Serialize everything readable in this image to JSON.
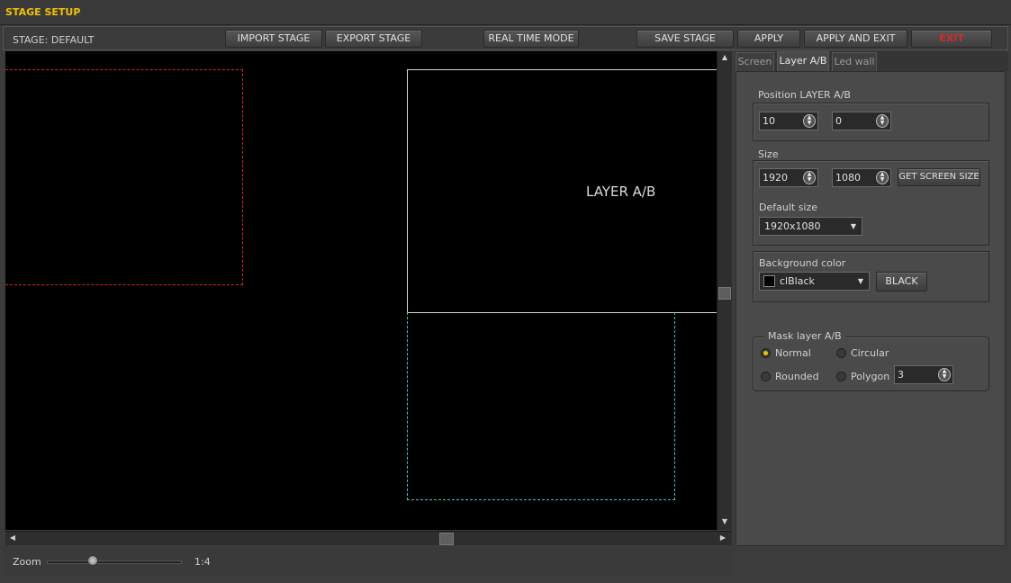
{
  "window": {
    "title": "STAGE SETUP"
  },
  "toolbar": {
    "stage_label": "STAGE: DEFAULT",
    "import_label": "IMPORT STAGE",
    "export_label": "EXPORT STAGE",
    "realtime_label": "REAL TIME MODE",
    "save_label": "SAVE STAGE",
    "apply_label": "APPLY",
    "apply_exit_label": "APPLY AND EXIT",
    "exit_label": "EXIT"
  },
  "canvas": {
    "layer_label": "LAYER A/B"
  },
  "zoom": {
    "label": "Zoom",
    "value": "1:4",
    "level_fraction": 0.34
  },
  "tabs": [
    {
      "label": "Screen"
    },
    {
      "label": "Layer A/B",
      "active": true
    },
    {
      "label": "Led wall"
    }
  ],
  "position": {
    "label": "Position LAYER A/B",
    "x": "10",
    "y": "0"
  },
  "size": {
    "label": "Size",
    "width": "1920",
    "height": "1080",
    "get_screen_size_label": "GET SCREEN SIZE",
    "default_size_label": "Default size",
    "default_size_value": "1920x1080"
  },
  "background": {
    "label": "Background color",
    "color_name": "clBlack",
    "color_button_label": "BLACK",
    "swatch": "#000000"
  },
  "mask": {
    "label": "Mask layer A/B",
    "normal_label": "Normal",
    "circular_label": "Circular",
    "rounded_label": "Rounded",
    "polygon_label": "Polygon",
    "polygon_sides": "3",
    "selected": "Normal"
  },
  "colors": {
    "accent": "#f2c200",
    "exit": "#d42a2a",
    "red_outline": "#e02020",
    "cyan_outline": "#40c8c8"
  },
  "icons": [
    "scroll-up-icon",
    "scroll-down-icon",
    "scroll-left-icon",
    "scroll-right-icon",
    "spin-arrows-icon",
    "dropdown-caret-icon"
  ]
}
